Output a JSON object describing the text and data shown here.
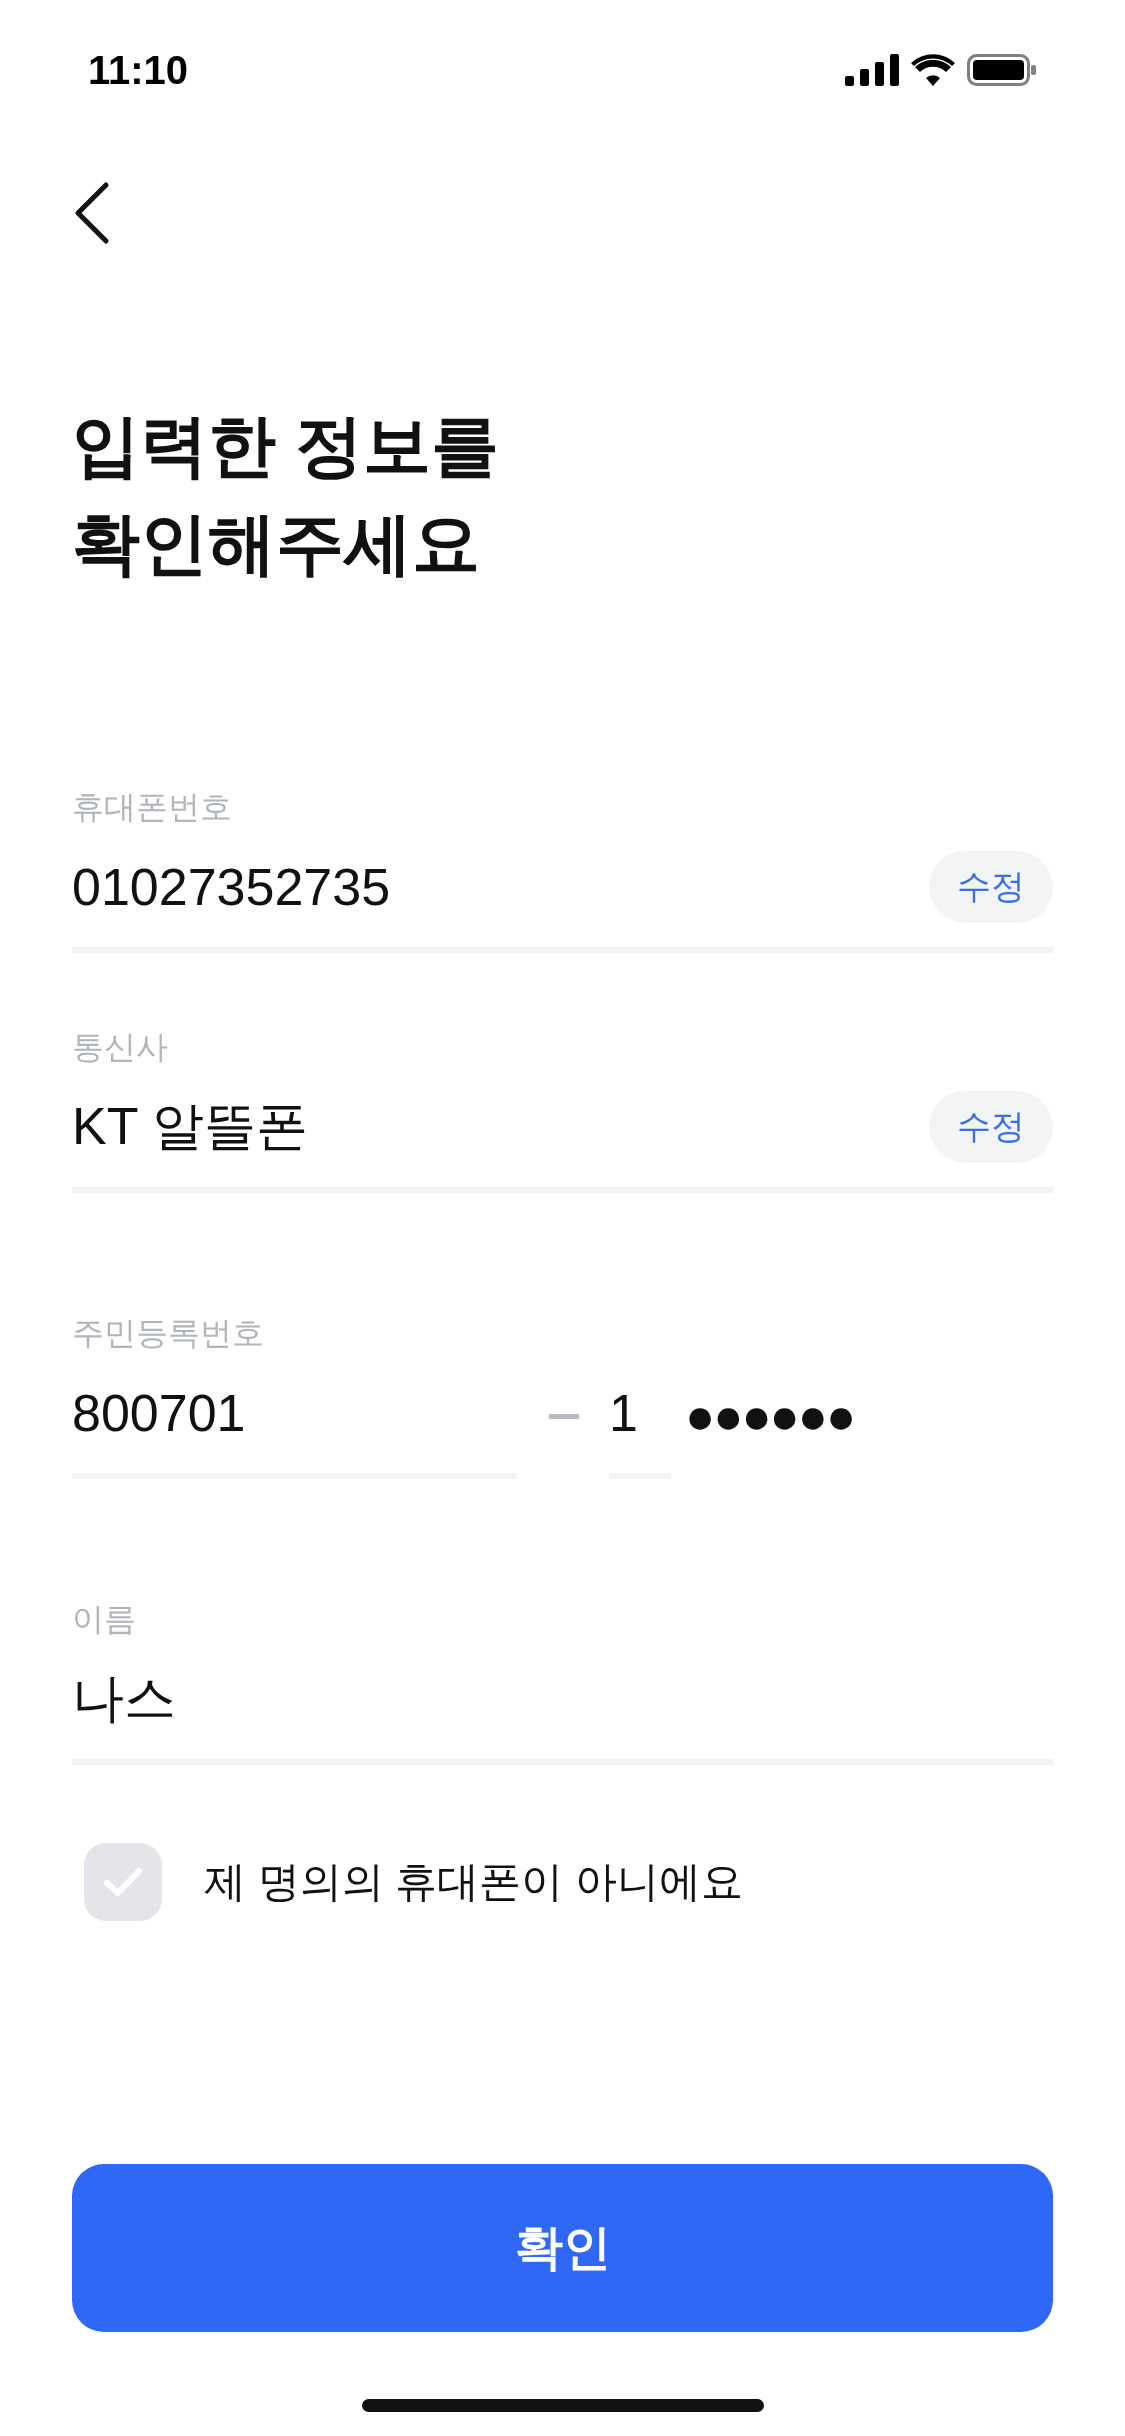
{
  "status_bar": {
    "time": "11:10"
  },
  "title": "입력한 정보를\n확인해주세요",
  "fields": [
    {
      "kind": "single",
      "label": "휴대폰번호",
      "value": "01027352735",
      "edit": "수정"
    },
    {
      "kind": "single",
      "label": "통신사",
      "value": "KT 알뜰폰",
      "edit": "수정"
    },
    {
      "kind": "resident",
      "label": "주민등록번호",
      "front": "800701",
      "back_first": "1",
      "back_masked": "●●●●●●"
    },
    {
      "kind": "single",
      "label": "이름",
      "value": "나스"
    }
  ],
  "consent": {
    "label": "제 명의의 휴대폰이 아니에요",
    "checked": false
  },
  "confirm_button": "확인"
}
